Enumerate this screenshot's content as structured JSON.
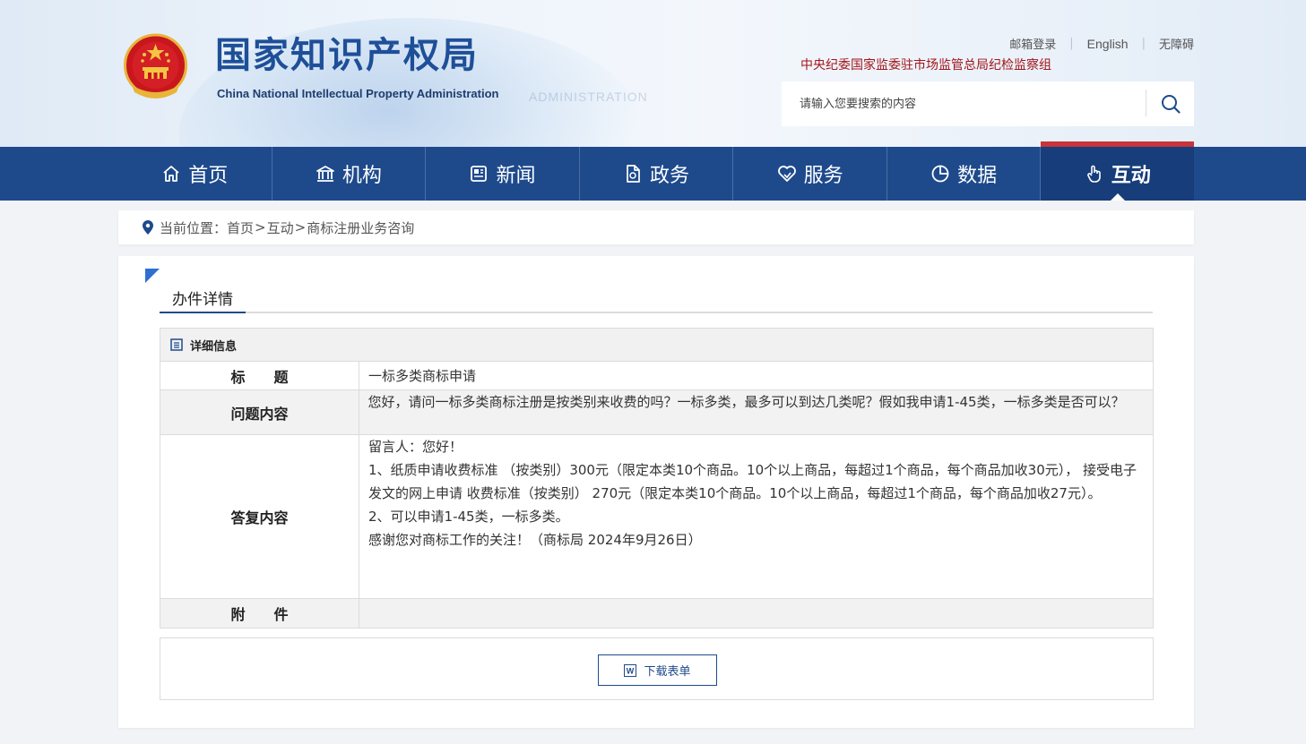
{
  "site": {
    "name_cn": "国家知识产权局",
    "name_en": "China National Intellectual Property Administration",
    "banner_ghost": "ADMINISTRATION"
  },
  "top_links": {
    "mail": "邮箱登录",
    "english": "English",
    "accessibility": "无障碍",
    "discipline": "中央纪委国家监委驻市场监管总局纪检监察组"
  },
  "search": {
    "placeholder": "请输入您要搜索的内容"
  },
  "nav": {
    "items": [
      {
        "label": "首页",
        "icon": "home-icon"
      },
      {
        "label": "机构",
        "icon": "institution-icon"
      },
      {
        "label": "新闻",
        "icon": "news-icon"
      },
      {
        "label": "政务",
        "icon": "document-icon"
      },
      {
        "label": "服务",
        "icon": "service-icon"
      },
      {
        "label": "数据",
        "icon": "pie-chart-icon"
      },
      {
        "label": "互动",
        "icon": "hand-pointer-icon",
        "active": true
      }
    ]
  },
  "breadcrumb": {
    "prefix": "当前位置：",
    "items": [
      "首页",
      "互动",
      "商标注册业务咨询"
    ],
    "separator": ">"
  },
  "section": {
    "title": "办件详情"
  },
  "detail": {
    "header": "详细信息",
    "rows": {
      "title": {
        "label": "标　　题",
        "value": "一标多类商标申请"
      },
      "question": {
        "label": "问题内容",
        "value": "  您好，请问一标多类商标注册是按类别来收费的吗？一标多类，最多可以到达几类呢？假如我申请1-45类，一标多类是否可以？"
      },
      "answer": {
        "label": "答复内容",
        "lines": [
          "留言人：您好！",
          "1、纸质申请收费标准 （按类别）300元（限定本类10个商品。10个以上商品，每超过1个商品，每个商品加收30元）， 接受电子发文的网上申请 收费标准（按类别） 270元（限定本类10个商品。10个以上商品，每超过1个商品，每个商品加收27元）。",
          "2、可以申请1-45类，一标多类。",
          "感谢您对商标工作的关注！（商标局 2024年9月26日）"
        ]
      },
      "attachment": {
        "label": "附　　件",
        "value": ""
      }
    }
  },
  "download": {
    "label": "下载表单"
  },
  "colors": {
    "nav_bg": "#1e4a8c",
    "nav_active": "#173d7a",
    "accent_red": "#c7353a",
    "brand_blue": "#1e4f98"
  }
}
